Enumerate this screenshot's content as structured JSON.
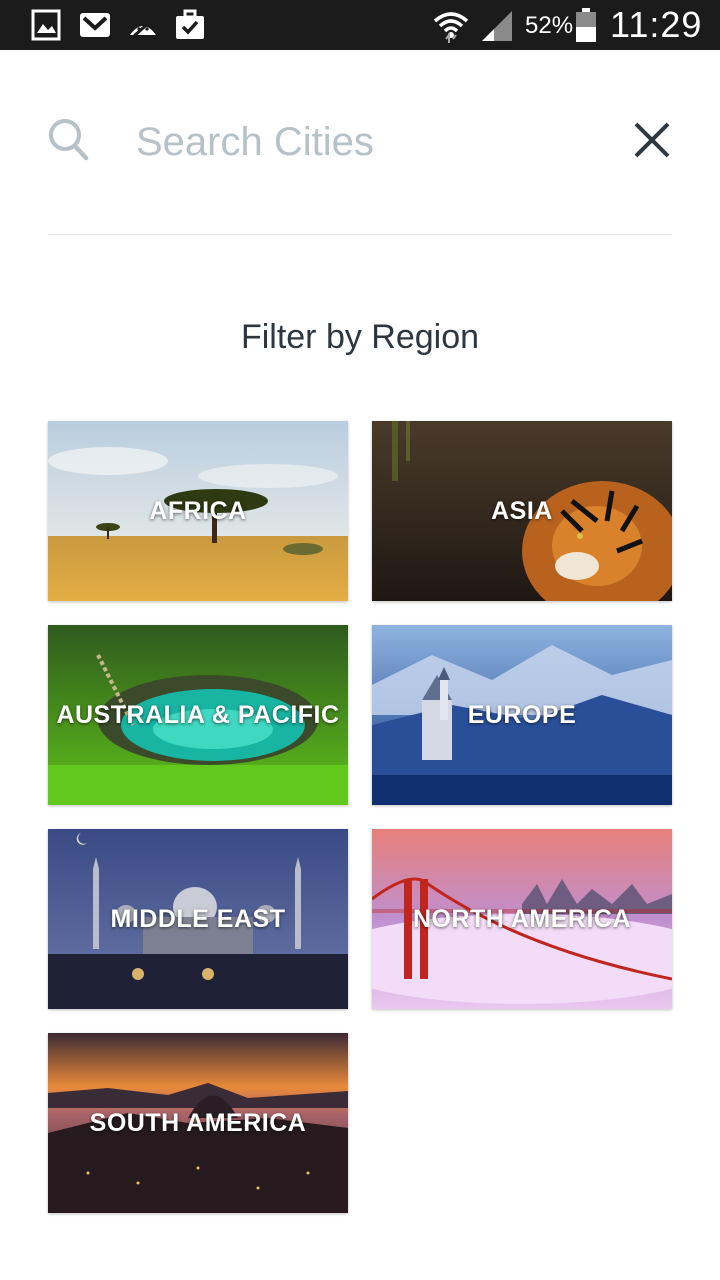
{
  "status_bar": {
    "battery_percent": "52%",
    "time": "11:29",
    "icons": [
      "gallery-icon",
      "gmail-icon",
      "android-debug-icon",
      "briefcase-check-icon",
      "wifi-icon",
      "cell-signal-icon",
      "battery-icon"
    ]
  },
  "search": {
    "placeholder": "Search Cities",
    "value": "",
    "icon": "search-icon",
    "close_icon": "close-icon"
  },
  "filter": {
    "title": "Filter by Region",
    "regions": [
      {
        "label": "AFRICA"
      },
      {
        "label": "ASIA"
      },
      {
        "label": "AUSTRALIA & PACIFIC"
      },
      {
        "label": "EUROPE"
      },
      {
        "label": "MIDDLE EAST"
      },
      {
        "label": "NORTH AMERICA"
      },
      {
        "label": "SOUTH AMERICA"
      }
    ]
  },
  "colors": {
    "status_bar_bg": "#1b1b1b",
    "placeholder": "#b6c1c8",
    "title_text": "#2e3740",
    "divider": "#e3e6e8"
  }
}
